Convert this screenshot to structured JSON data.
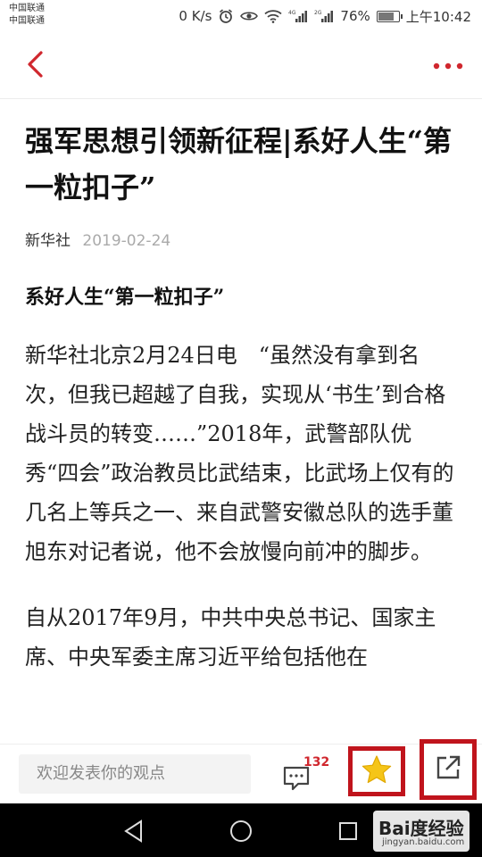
{
  "status_bar": {
    "carrier_1": "中国联通",
    "carrier_2": "中国联通",
    "speed": "0 K/s",
    "network_4g": "4G",
    "network_2g": "2G",
    "battery": "76%",
    "time": "上午10:42"
  },
  "article": {
    "title": "强军思想引领新征程|系好人生“第一粒扣子”",
    "source": "新华社",
    "date": "2019-02-24",
    "subheading": "系好人生“第一粒扣子”",
    "paragraphs": [
      "新华社北京2月24日电　“虽然没有拿到名次，但我已超越了自我，实现从‘书生’到合格战斗员的转变……”2018年，武警部队优秀“四会”政治教员比武结束，比武场上仅有的几名上等兵之一、来自武警安徽总队的选手董旭东对记者说，他不会放慢向前冲的脚步。",
      "自从2017年9月，中共中央总书记、国家主席、中央军委主席习近平给包括他在"
    ]
  },
  "toolbar": {
    "comment_placeholder": "欢迎发表你的观点",
    "comment_count": "132"
  },
  "watermark": {
    "main": "Bai度经验",
    "sub": "jingyan.baidu.com"
  },
  "colors": {
    "accent": "#d0272e",
    "highlight_box": "#c0141c",
    "star": "#f5c518"
  }
}
